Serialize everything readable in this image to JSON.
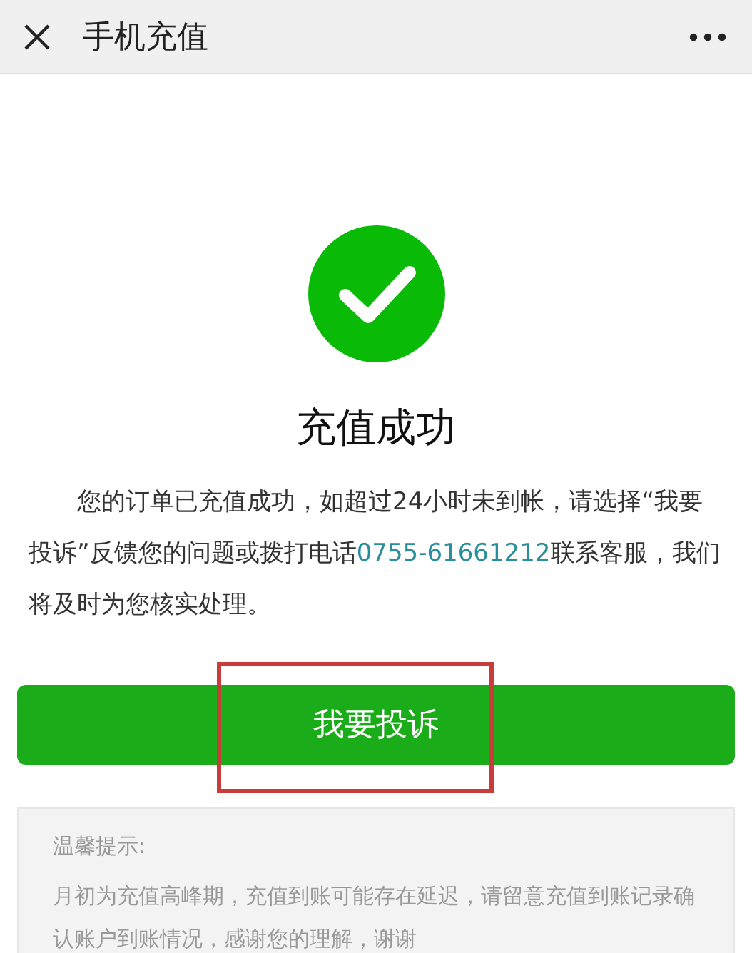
{
  "nav_bar": {
    "title": "手机充值"
  },
  "result": {
    "success": true,
    "title": "充值成功"
  },
  "message": {
    "before": "您的订单已充值成功，如超过24小时未到帐，请选择“我要投诉”反馈您的问题或拨打电话",
    "phone": "0755-61661212",
    "after": "联系客服，我们将及时为您核实处理。"
  },
  "complaint_button": {
    "label": "我要投诉",
    "highlighted": true
  },
  "tips": {
    "title": "温馨提示:",
    "text": "月初为充值高峰期，充值到账可能存在延迟，请留意充值到账记录确认账户到账情况，感谢您的理解，谢谢"
  }
}
